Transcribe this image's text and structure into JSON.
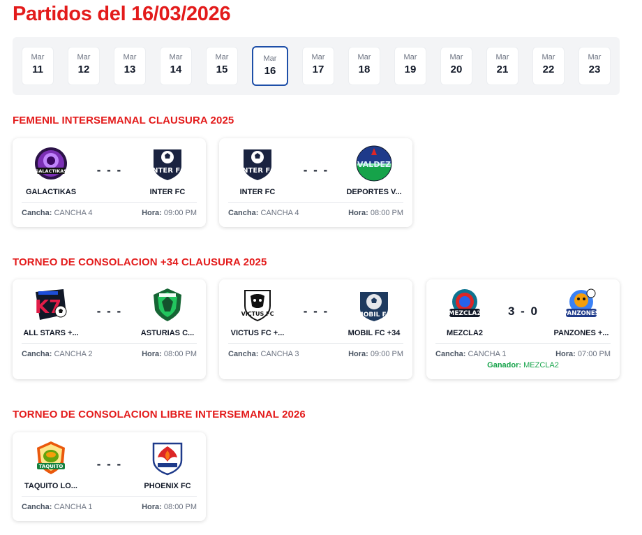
{
  "header": {
    "title": "Partidos del 16/03/2026"
  },
  "dates": [
    {
      "month": "Mar",
      "day": "11"
    },
    {
      "month": "Mar",
      "day": "12"
    },
    {
      "month": "Mar",
      "day": "13"
    },
    {
      "month": "Mar",
      "day": "14"
    },
    {
      "month": "Mar",
      "day": "15"
    },
    {
      "month": "Mar",
      "day": "16",
      "active": true
    },
    {
      "month": "Mar",
      "day": "17"
    },
    {
      "month": "Mar",
      "day": "18"
    },
    {
      "month": "Mar",
      "day": "19"
    },
    {
      "month": "Mar",
      "day": "20"
    },
    {
      "month": "Mar",
      "day": "21"
    },
    {
      "month": "Mar",
      "day": "22"
    },
    {
      "month": "Mar",
      "day": "23"
    }
  ],
  "labels": {
    "court": "Cancha:",
    "time": "Hora:",
    "winner": "Ganador:"
  },
  "colors": {
    "accent": "#e31b1b",
    "active_border": "#1e4fa8",
    "winner": "#16a34a"
  },
  "tournaments": [
    {
      "name": "FEMENIL INTERSEMANAL CLAUSURA 2025",
      "matches": [
        {
          "home": "GALACTIKAS",
          "away": "INTER FC",
          "score": "- - -",
          "court": "CANCHA 4",
          "time": "09:00 PM",
          "home_logo": "galactikas-logo",
          "away_logo": "inter-fc-logo"
        },
        {
          "home": "INTER FC",
          "away": "DEPORTES V...",
          "score": "- - -",
          "court": "CANCHA 4",
          "time": "08:00 PM",
          "home_logo": "inter-fc-logo",
          "away_logo": "deportes-valdez-logo"
        }
      ]
    },
    {
      "name": "TORNEO DE CONSOLACION +34 CLAUSURA 2025",
      "matches": [
        {
          "home": "ALL STARS +...",
          "away": "ASTURIAS C...",
          "score": "- - -",
          "court": "CANCHA 2",
          "time": "08:00 PM",
          "home_logo": "all-stars-logo",
          "away_logo": "asturias-logo"
        },
        {
          "home": "VICTUS FC +...",
          "away": "MOBIL FC +34",
          "score": "- - -",
          "court": "CANCHA 3",
          "time": "09:00 PM",
          "home_logo": "victus-fc-logo",
          "away_logo": "mobil-fc-logo"
        },
        {
          "home": "MEZCLA2",
          "away": "PANZONES +...",
          "score": "3 - 0",
          "court": "CANCHA 1",
          "time": "07:00 PM",
          "winner": "MEZCLA2",
          "home_logo": "mezcla2-logo",
          "away_logo": "panzones-logo"
        }
      ]
    },
    {
      "name": "TORNEO DE CONSOLACION LIBRE INTERSEMANAL 2026",
      "matches": [
        {
          "home": "TAQUITO LO...",
          "away": "PHOENIX FC",
          "score": "- - -",
          "court": "CANCHA 1",
          "time": "08:00 PM",
          "home_logo": "taquito-logo",
          "away_logo": "phoenix-fc-logo"
        }
      ]
    }
  ]
}
